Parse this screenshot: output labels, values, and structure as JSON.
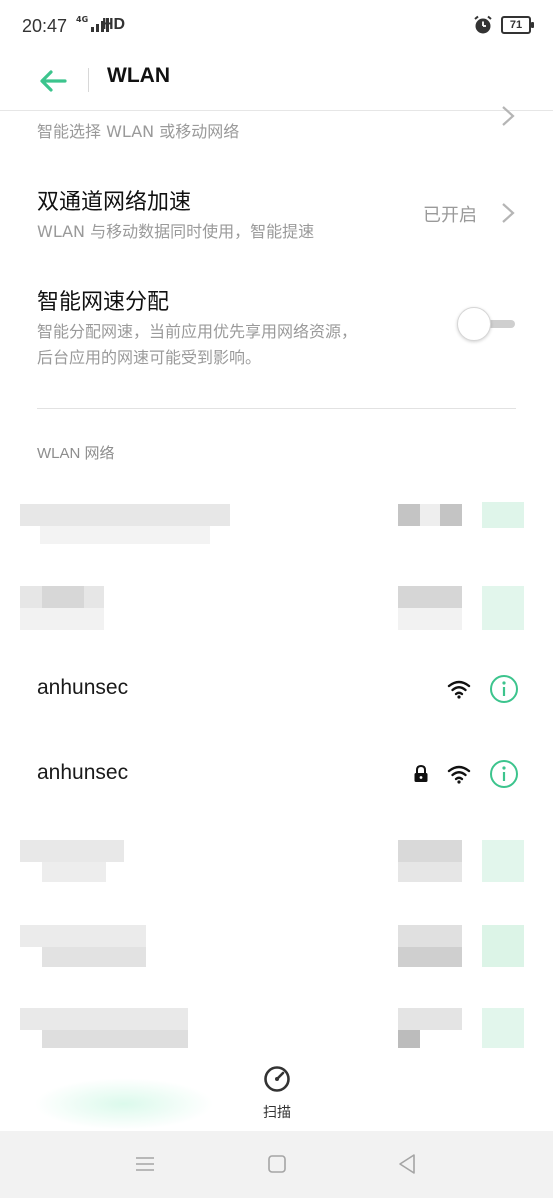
{
  "status": {
    "time": "20:47",
    "network_type": "4G",
    "hd": "HD",
    "battery": "71"
  },
  "header": {
    "title": "WLAN"
  },
  "settings": {
    "smart_select_sub": "智能选择 WLAN 或移动网络",
    "dual_channel": {
      "title": "双通道网络加速",
      "sub": "WLAN 与移动数据同时使用，智能提速",
      "value": "已开启"
    },
    "smart_speed": {
      "title": "智能网速分配",
      "sub_line1": "智能分配网速，当前应用优先享用网络资源，",
      "sub_line2": "后台应用的网速可能受到影响。",
      "enabled": false
    }
  },
  "section": {
    "label": "WLAN 网络"
  },
  "networks": [
    {
      "name": "anhunsec",
      "locked": false
    },
    {
      "name": "anhunsec",
      "locked": true
    }
  ],
  "scan": {
    "label": "扫描"
  },
  "colors": {
    "accent": "#3cc48d",
    "redacted_light": "#ececec",
    "redacted_dark": "#bcbcbc",
    "redacted_green": "#dcf5ea"
  }
}
